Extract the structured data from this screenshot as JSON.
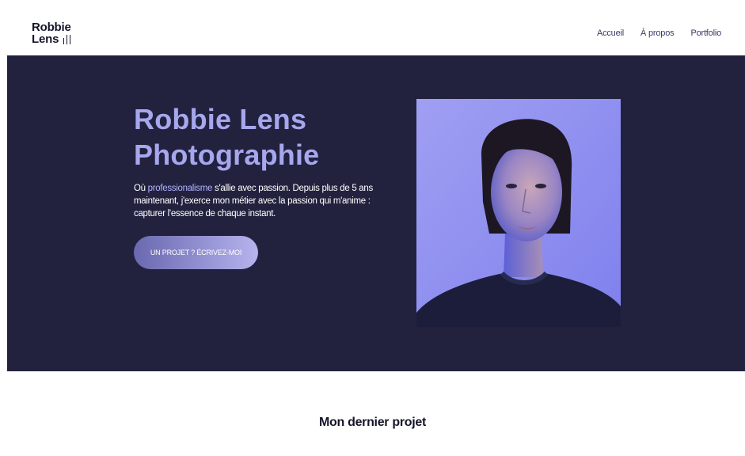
{
  "header": {
    "logo_line1": "Robbie",
    "logo_line2": "Lens",
    "nav": [
      "Accueil",
      "À propos",
      "Portfolio"
    ]
  },
  "hero": {
    "title_line1": "Robbie Lens",
    "title_line2": "Photographie",
    "desc_prefix": "Où ",
    "desc_accent": "professionalisme",
    "desc_rest": " s'allie avec passion. Depuis plus de 5 ans maintenant, j'exerce mon métier avec la passion qui m'anime : capturer l'essence de chaque instant.",
    "cta_label": "UN PROJET ? ÉCRIVEZ-MOI"
  },
  "section": {
    "title": "Mon dernier projet"
  },
  "colors": {
    "hero_bg": "#22223f",
    "title_accent": "#a7a7ee",
    "cta_gradient_start": "#6a68b0",
    "cta_gradient_end": "#b6b3ee",
    "portrait_bg": "#8e8ef0"
  }
}
